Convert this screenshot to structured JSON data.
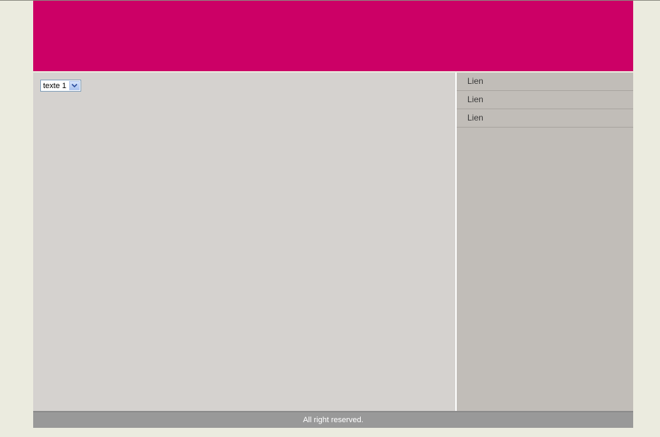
{
  "colors": {
    "background": "#ebebdf",
    "header": "#cc0066",
    "main": "#d5d2cf",
    "sidebar": "#c1bdb8",
    "footer": "#999999"
  },
  "main": {
    "select": {
      "selected_value": "texte 1",
      "icon": "chevron-down-icon"
    }
  },
  "sidebar": {
    "links": [
      {
        "label": "Lien"
      },
      {
        "label": "Lien"
      },
      {
        "label": "Lien"
      }
    ]
  },
  "footer": {
    "text": "All right reserved."
  }
}
